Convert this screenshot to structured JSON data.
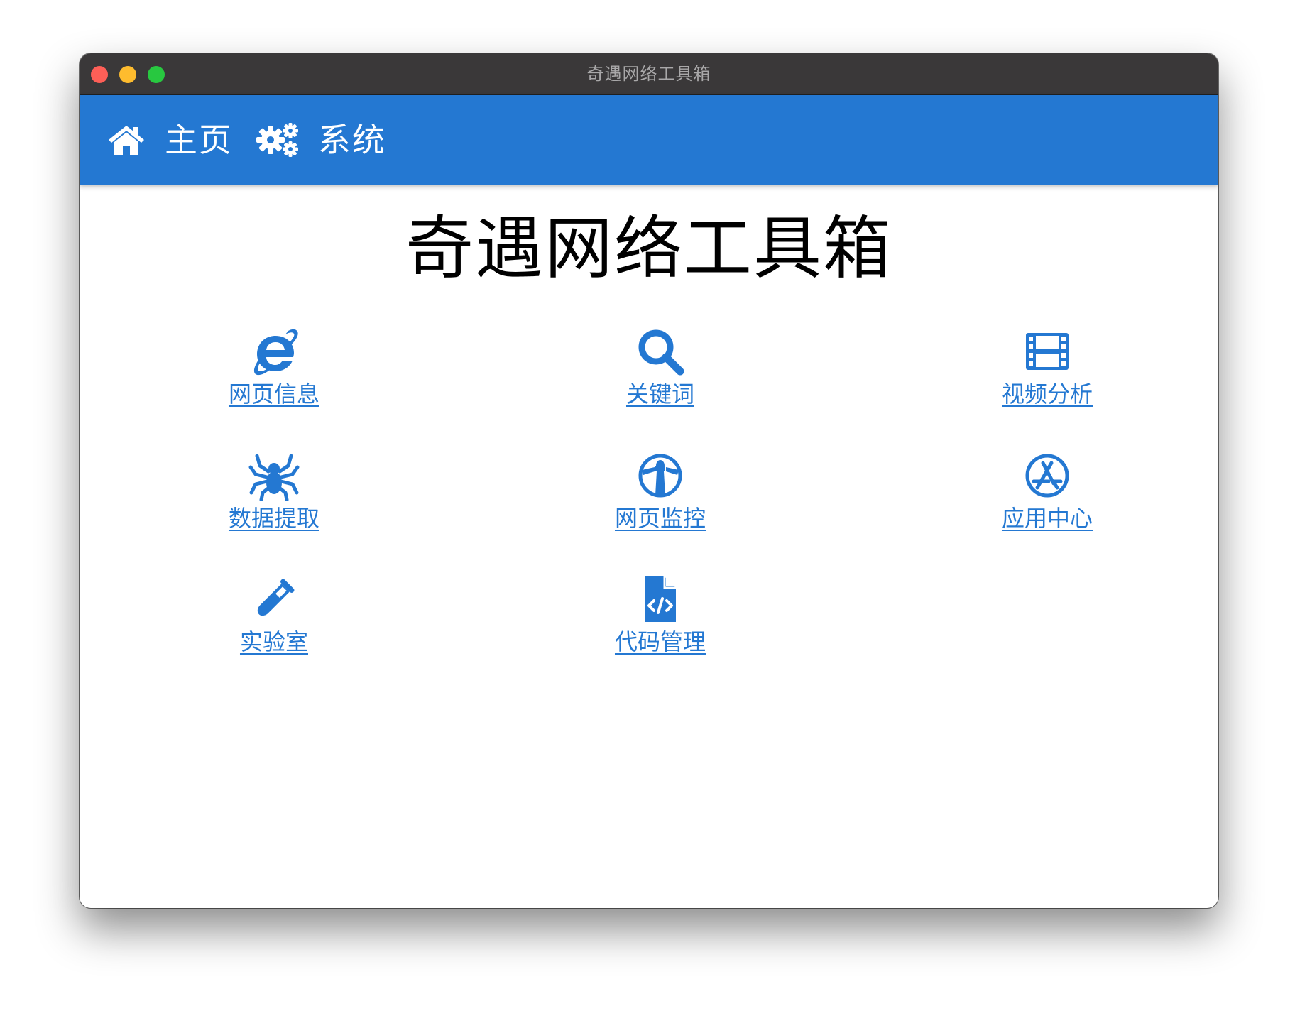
{
  "window": {
    "title": "奇遇网络工具箱"
  },
  "navbar": {
    "home": {
      "label": "主页",
      "icon": "home-icon"
    },
    "system": {
      "label": "系统",
      "icon": "gears-icon"
    }
  },
  "main": {
    "title": "奇遇网络工具箱",
    "tools": [
      {
        "label": "网页信息",
        "icon": "internet-explorer-icon"
      },
      {
        "label": "关键词",
        "icon": "search-icon"
      },
      {
        "label": "视频分析",
        "icon": "film-icon"
      },
      {
        "label": "数据提取",
        "icon": "spider-icon"
      },
      {
        "label": "网页监控",
        "icon": "lighthouse-icon"
      },
      {
        "label": "应用中心",
        "icon": "app-store-icon"
      },
      {
        "label": "实验室",
        "icon": "test-tube-icon"
      },
      {
        "label": "代码管理",
        "icon": "code-file-icon"
      }
    ]
  },
  "colors": {
    "accent": "#2478d2",
    "titlebar": "#3a3839",
    "traffic_red": "#fe5f57",
    "traffic_yellow": "#febc2e",
    "traffic_green": "#28c840"
  }
}
